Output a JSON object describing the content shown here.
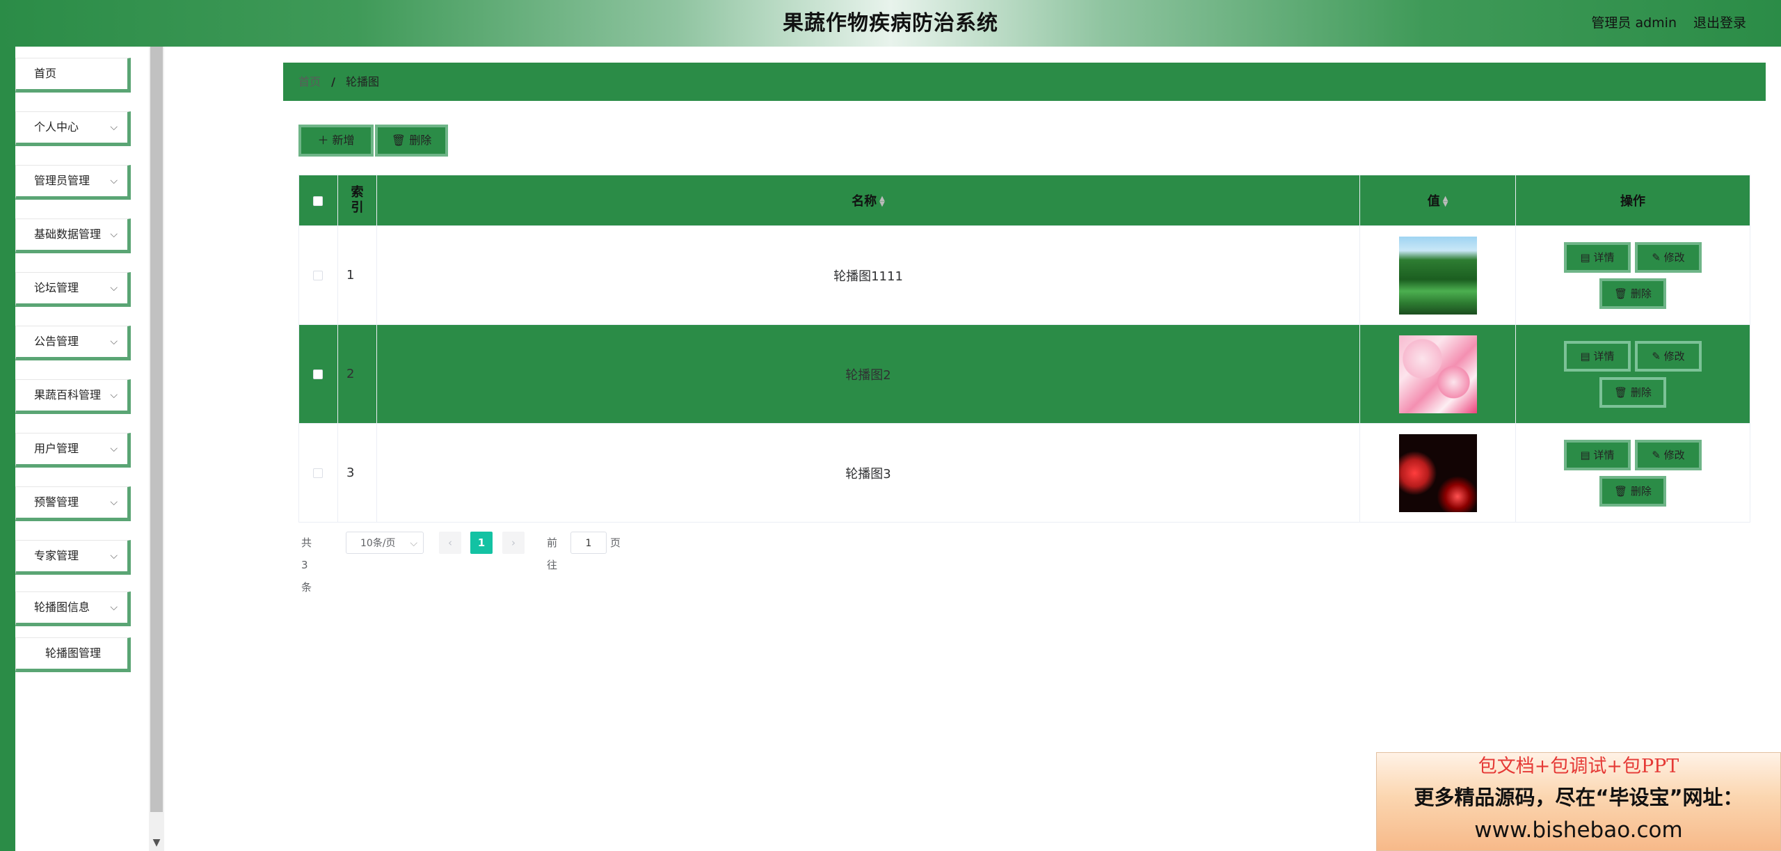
{
  "header": {
    "title": "果蔬作物疾病防治系统",
    "user": "管理员 admin",
    "logout": "退出登录"
  },
  "sidebar": {
    "items": [
      {
        "label": "首页",
        "has_arrow": false
      },
      {
        "label": "个人中心",
        "has_arrow": true
      },
      {
        "label": "管理员管理",
        "has_arrow": true
      },
      {
        "label": "基础数据管理",
        "has_arrow": true
      },
      {
        "label": "论坛管理",
        "has_arrow": true
      },
      {
        "label": "公告管理",
        "has_arrow": true
      },
      {
        "label": "果蔬百科管理",
        "has_arrow": true
      },
      {
        "label": "用户管理",
        "has_arrow": true
      },
      {
        "label": "预警管理",
        "has_arrow": true
      },
      {
        "label": "专家管理",
        "has_arrow": true
      },
      {
        "label": "轮播图信息",
        "has_arrow": true
      }
    ],
    "sub_item": "轮播图管理",
    "chevron": "⌵"
  },
  "breadcrumb": {
    "home": "首页",
    "separator": "/",
    "current": "轮播图"
  },
  "toolbar": {
    "add_label": "＋ 新增",
    "delete_label": "🗑 删除"
  },
  "table": {
    "columns": {
      "index": "索引",
      "name": "名称",
      "value": "值",
      "actions": "操作"
    },
    "rows": [
      {
        "index": "1",
        "name": "轮播图1111",
        "image": "forest",
        "highlighted": false
      },
      {
        "index": "2",
        "name": "轮播图2",
        "image": "cherry-blossom",
        "highlighted": true
      },
      {
        "index": "3",
        "name": "轮播图3",
        "image": "red-lanterns",
        "highlighted": false
      }
    ],
    "action_labels": {
      "detail": "▤ 详情",
      "edit": "✎ 修改",
      "delete": "🗑 删除"
    }
  },
  "pagination": {
    "total": "共 3 条",
    "page_size": "10条/页",
    "prev": "‹",
    "current_page": "1",
    "next": "›",
    "goto_prefix": "前往",
    "goto_value": "1",
    "goto_suffix": "页"
  },
  "ad": {
    "line1": "包文档+包调试+包PPT",
    "line2": "更多精品源码，尽在“毕设宝”网址：",
    "line3": "www.bishebao.com"
  },
  "colors": {
    "primary_green": "#2b8c47",
    "button_border": "#6fb588",
    "active_page": "#13c2a3"
  }
}
